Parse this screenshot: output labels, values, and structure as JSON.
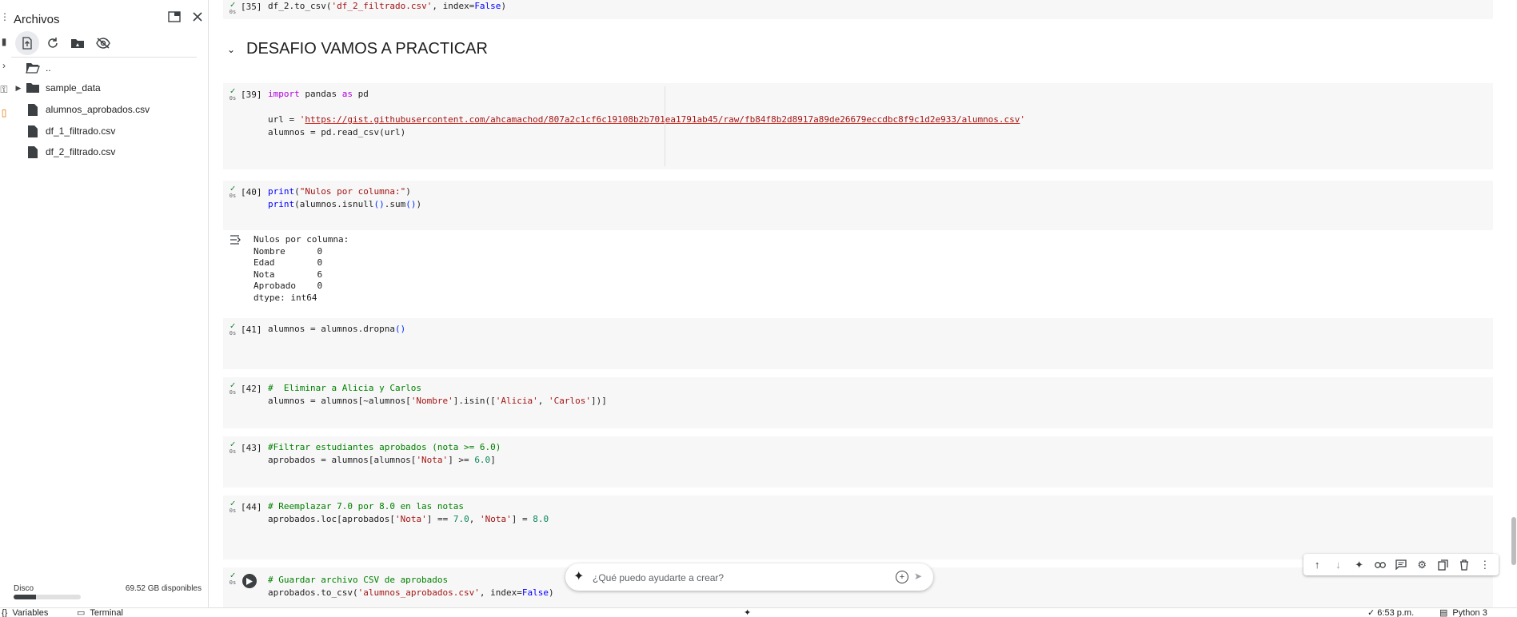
{
  "files_panel": {
    "title": "Archivos",
    "tree": [
      {
        "name": "..",
        "type": "folder-open"
      },
      {
        "name": "sample_data",
        "type": "folder"
      },
      {
        "name": "alumnos_aprobados.csv",
        "type": "file"
      },
      {
        "name": "df_1_filtrado.csv",
        "type": "file"
      },
      {
        "name": "df_2_filtrado.csv",
        "type": "file"
      }
    ],
    "disk_label": "Disco",
    "disk_available": "69.52 GB disponibles",
    "disk_used_fraction": 0.33
  },
  "notebook": {
    "cells": [
      {
        "count": "[35]",
        "time": "0s"
      },
      {
        "count": "[39]",
        "time": "0s"
      },
      {
        "count": "[40]",
        "time": "0s"
      },
      {
        "count": "[41]",
        "time": "0s"
      },
      {
        "count": "[42]",
        "time": "0s"
      },
      {
        "count": "[43]",
        "time": "0s"
      },
      {
        "count": "[44]",
        "time": "0s"
      },
      {
        "count": "",
        "time": "0s"
      }
    ],
    "section_title": "DESAFIO VAMOS A PRACTICAR",
    "output_40": "Nulos por columna:\nNombre      0\nEdad        0\nNota        6\nAprobado    0\ndtype: int64"
  },
  "prompt": {
    "placeholder": "¿Qué puedo ayudarte a crear?"
  },
  "statusbar": {
    "variables": "Variables",
    "terminal": "Terminal",
    "time": "✓ 6:53 p.m.",
    "runtime": "Python 3"
  }
}
